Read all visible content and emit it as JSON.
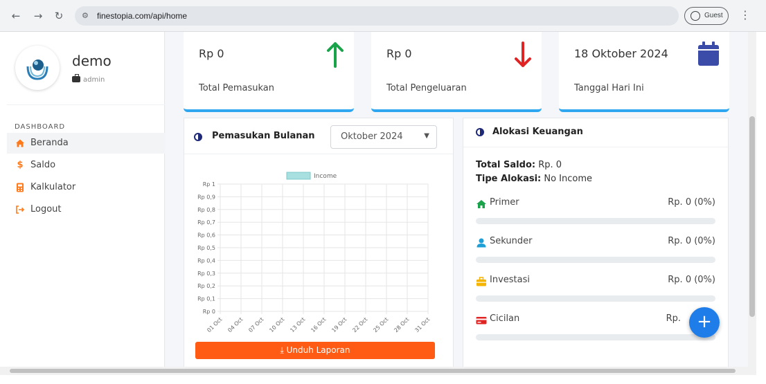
{
  "browser": {
    "url": "finestopia.com/api/home",
    "profile_label": "Guest"
  },
  "sidebar": {
    "username": "demo",
    "role": "admin",
    "section_label": "DASHBOARD",
    "items": [
      {
        "label": "Beranda",
        "icon": "home-icon",
        "active": true
      },
      {
        "label": "Saldo",
        "icon": "dollar-icon",
        "active": false
      },
      {
        "label": "Kalkulator",
        "icon": "calculator-icon",
        "active": false
      },
      {
        "label": "Logout",
        "icon": "logout-icon",
        "active": false
      }
    ]
  },
  "stats": [
    {
      "value": "Rp 0",
      "label": "Total Pemasukan",
      "icon": "arrow-up-icon",
      "color": "#1aa34a"
    },
    {
      "value": "Rp 0",
      "label": "Total Pengeluaran",
      "icon": "arrow-down-icon",
      "color": "#e02424"
    },
    {
      "value": "18 Oktober 2024",
      "label": "Tanggal Hari Ini",
      "icon": "calendar-icon",
      "color": "#3b4ba8"
    }
  ],
  "income_panel": {
    "title": "Pemasukan Bulanan",
    "month_selected": "Oktober 2024",
    "download_label": "Unduh Laporan"
  },
  "chart_data": {
    "type": "bar",
    "legend": [
      "Income"
    ],
    "legend_position": "top",
    "categories": [
      "01 Oct",
      "04 Oct",
      "07 Oct",
      "10 Oct",
      "13 Oct",
      "16 Oct",
      "19 Oct",
      "22 Oct",
      "25 Oct",
      "28 Oct",
      "31 Oct"
    ],
    "series": [
      {
        "name": "Income",
        "values": [
          0,
          0,
          0,
          0,
          0,
          0,
          0,
          0,
          0,
          0,
          0
        ]
      }
    ],
    "y_ticks": [
      "Rp 1",
      "Rp 0,9",
      "Rp 0,8",
      "Rp 0,7",
      "Rp 0,6",
      "Rp 0,5",
      "Rp 0,4",
      "Rp 0,3",
      "Rp 0,2",
      "Rp 0,1",
      "Rp 0"
    ],
    "ylim": [
      0,
      1
    ],
    "grid": true,
    "colors": {
      "income": "#a8dfe0"
    }
  },
  "alokasi": {
    "title": "Alokasi Keuangan",
    "total_saldo_label": "Total Saldo:",
    "total_saldo_value": "Rp. 0",
    "tipe_label": "Tipe Alokasi:",
    "tipe_value": "No Income",
    "items": [
      {
        "name": "Primer",
        "value": "Rp. 0 (0%)",
        "icon": "home-icon",
        "color": "#1aa34a",
        "fraction": 0
      },
      {
        "name": "Sekunder",
        "value": "Rp. 0 (0%)",
        "icon": "user-icon",
        "color": "#1e9fd6",
        "fraction": 0
      },
      {
        "name": "Investasi",
        "value": "Rp. 0 (0%)",
        "icon": "briefcase-icon",
        "color": "#f5b400",
        "fraction": 0
      },
      {
        "name": "Cicilan",
        "value": "Rp.",
        "icon": "credit-card-icon",
        "color": "#e02424",
        "fraction": 0
      }
    ]
  },
  "fab": {
    "label": "+"
  }
}
